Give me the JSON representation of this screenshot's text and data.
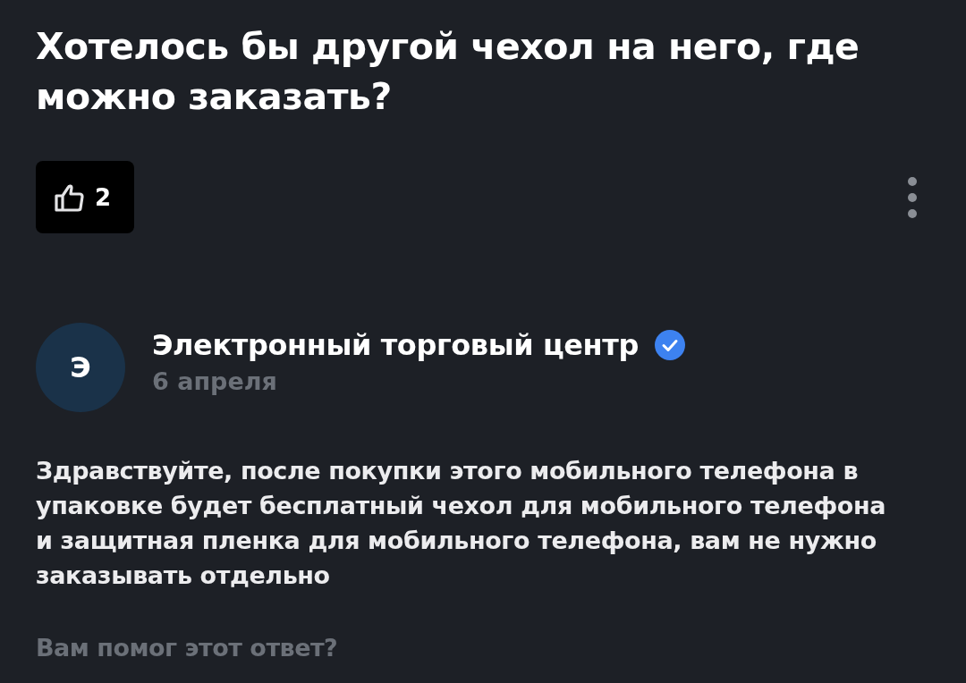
{
  "question": {
    "title": "Хотелось бы другой чехол на него, где можно заказать?",
    "likes": "2"
  },
  "answer": {
    "avatar_letter": "Э",
    "author": "Электронный торговый центр",
    "verified": true,
    "date": "6 апреля",
    "text": "Здравствуйте, после покупки этого мобильного телефона в упаковке будет бесплатный чехол для мобильного телефона и защитная пленка для мобильного телефона, вам не нужно заказывать отдельно"
  },
  "feedback": {
    "prompt": "Вам помог этот ответ?"
  }
}
